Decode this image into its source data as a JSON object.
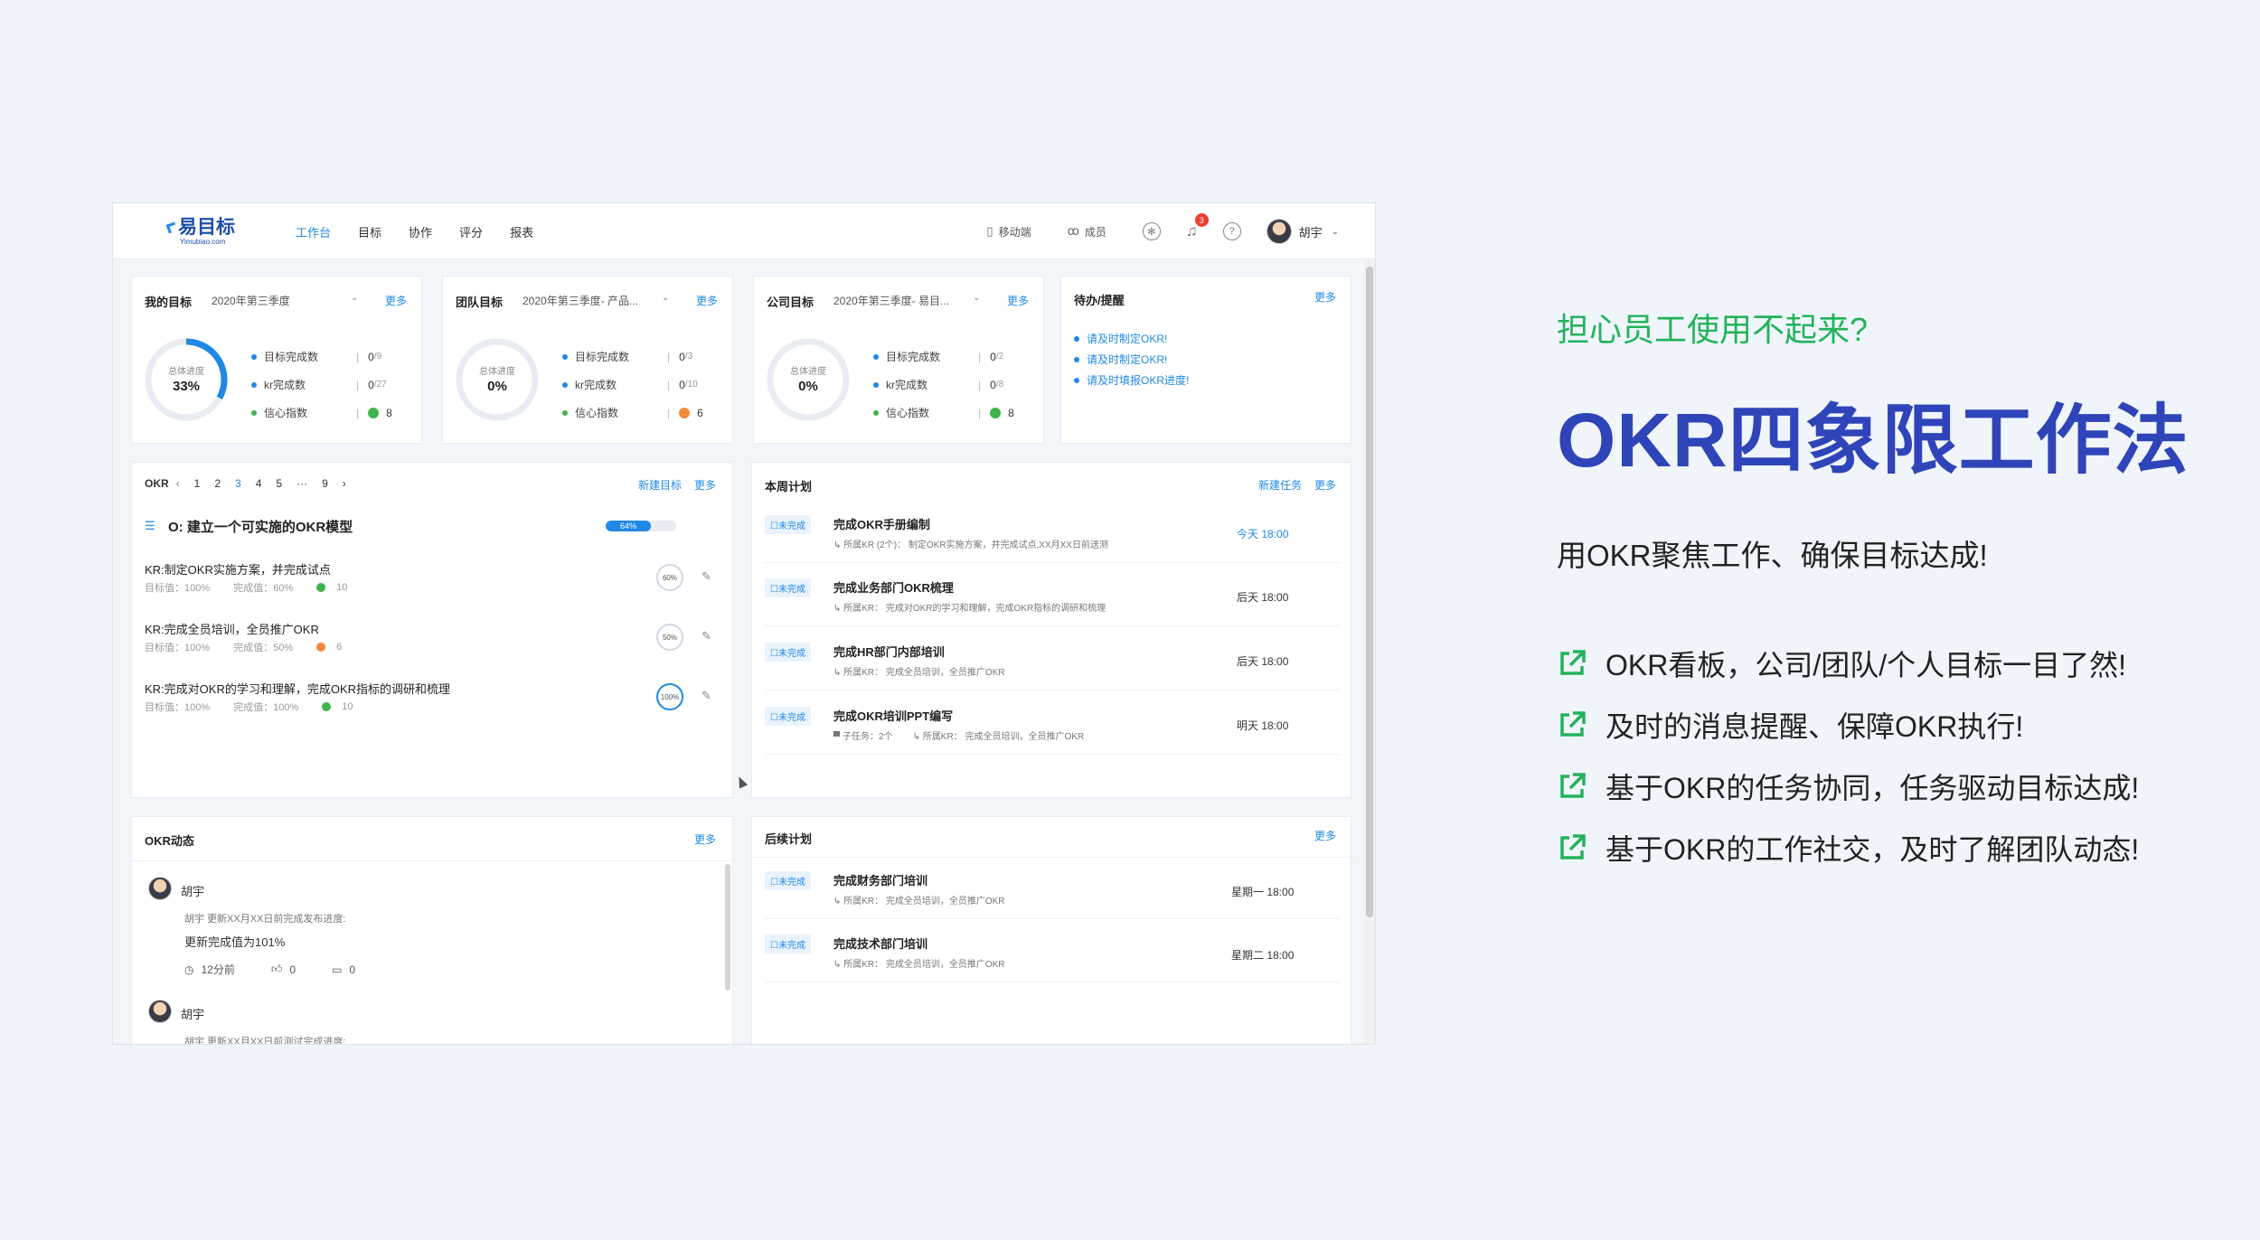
{
  "topbar": {
    "logo": "易目标",
    "logo_sub": "Yimubiao.com",
    "nav": [
      "工作台",
      "目标",
      "协作",
      "评分",
      "报表"
    ],
    "mobile": "移动端",
    "members": "成员",
    "bell_count": "3",
    "help": "?",
    "user": "胡宇"
  },
  "cards": {
    "my": {
      "title": "我的目标",
      "season": "2020年第三季度",
      "more": "更多",
      "progress_label": "总体进度",
      "progress": "33%",
      "progress_value": 0.33,
      "goal_label": "目标完成数",
      "goal_num": "0",
      "goal_den": "/9",
      "kr_label": "kr完成数",
      "kr_num": "0",
      "kr_den": "/27",
      "conf_label": "信心指数",
      "conf": "8"
    },
    "team": {
      "title": "团队目标",
      "season": "2020年第三季度- 产品...",
      "more": "更多",
      "progress_label": "总体进度",
      "progress": "0%",
      "progress_value": 0,
      "goal_label": "目标完成数",
      "goal_num": "0",
      "goal_den": "/3",
      "kr_label": "kr完成数",
      "kr_num": "0",
      "kr_den": "/10",
      "conf_label": "信心指数",
      "conf": "6"
    },
    "company": {
      "title": "公司目标",
      "season": "2020年第三季度- 易目...",
      "more": "更多",
      "progress_label": "总体进度",
      "progress": "0%",
      "progress_value": 0,
      "goal_label": "目标完成数",
      "goal_num": "0",
      "goal_den": "/2",
      "kr_label": "kr完成数",
      "kr_num": "0",
      "kr_den": "/8",
      "conf_label": "信心指数",
      "conf": "8"
    },
    "todo": {
      "title": "待办/提醒",
      "more": "更多",
      "items": [
        "请及时制定OKR!",
        "请及时制定OKR!",
        "请及时填报OKR进度!"
      ]
    }
  },
  "okr": {
    "label": "OKR",
    "pages": [
      "1",
      "2",
      "3",
      "4",
      "5",
      "···",
      "9"
    ],
    "current_page": "3",
    "new_goal": "新建目标",
    "more": "更多",
    "objective": "O: 建立一个可实施的OKR模型",
    "objective_progress": "64%",
    "objective_progress_value": 0.64,
    "krs": [
      {
        "title": "KR:制定OKR实施方案，并完成试点",
        "target": "目标值：100%",
        "done": "完成值：60%",
        "conf": "10",
        "pct": "60%",
        "conf_color": "#3cb54a"
      },
      {
        "title": "KR:完成全员培训，全员推广OKR",
        "target": "目标值：100%",
        "done": "完成值：50%",
        "conf": "6",
        "pct": "50%",
        "conf_color": "#f08a3c"
      },
      {
        "title": "KR:完成对OKR的学习和理解，完成OKR指标的调研和梳理",
        "target": "目标值：100%",
        "done": "完成值：100%",
        "conf": "10",
        "pct": "100%",
        "conf_color": "#3cb54a"
      }
    ]
  },
  "week": {
    "title": "本周计划",
    "new_task": "新建任务",
    "more": "更多",
    "tasks": [
      {
        "tag": "☐未完成",
        "title": "完成OKR手册编制",
        "sub": "↳ 所属KR (2个)： 制定OKR实施方案，并完成试点,XX月XX日前送测",
        "time": "今天 18:00"
      },
      {
        "tag": "☐未完成",
        "title": "完成业务部门OKR梳理",
        "sub": "↳ 所属KR： 完成对OKR的学习和理解，完成OKR指标的调研和梳理",
        "time": "后天 18:00"
      },
      {
        "tag": "☐未完成",
        "title": "完成HR部门内部培训",
        "sub": "↳ 所属KR： 完成全员培训，全员推广OKR",
        "time": "后天 18:00"
      },
      {
        "tag": "☐未完成",
        "title": "完成OKR培训PPT编写",
        "sub": "▀ 子任务：2个        ↳ 所属KR： 完成全员培训，全员推广OKR",
        "time": "明天 18:00"
      }
    ]
  },
  "feed": {
    "title": "OKR动态",
    "more": "更多",
    "items": [
      {
        "name": "胡宇",
        "line": "胡宇 更新XX月XX日前完成发布进度:",
        "main": "更新完成值为101%",
        "time": "12分前",
        "likes": "0",
        "comments": "0"
      },
      {
        "name": "胡宇",
        "line": "胡宇 更新XX月XX日前测试完成进度:"
      }
    ]
  },
  "later": {
    "title": "后续计划",
    "more": "更多",
    "tasks": [
      {
        "tag": "☐未完成",
        "title": "完成财务部门培训",
        "sub": "↳ 所属KR： 完成全员培训，全员推广OKR",
        "time": "星期一 18:00"
      },
      {
        "tag": "☐未完成",
        "title": "完成技术部门培训",
        "sub": "↳ 所属KR： 完成全员培训，全员推广OKR",
        "time": "星期二 18:00"
      }
    ]
  },
  "marketing": {
    "sub": "担心员工使用不起来?",
    "title": "OKR四象限工作法",
    "tagline": "用OKR聚焦工作、确保目标达成!",
    "points": [
      "OKR看板，公司/团队/个人目标一目了然!",
      "及时的消息提醒、保障OKR执行!",
      "基于OKR的任务协同，任务驱动目标达成!",
      "基于OKR的工作社交，及时了解团队动态!"
    ]
  },
  "colors": {
    "accent": "#1f88e5",
    "brand": "#2f44b8",
    "green": "#22b35a",
    "conf_green": "#3cb54a",
    "conf_orange": "#f08a3c"
  }
}
